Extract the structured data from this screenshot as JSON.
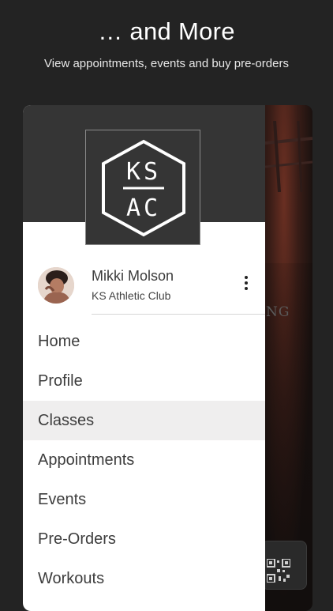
{
  "hero": {
    "title": "… and More",
    "subtitle": "View appointments, events and buy pre-orders"
  },
  "logo": {
    "line1": "KS",
    "line2": "AC"
  },
  "user": {
    "name": "Mikki Molson",
    "club": "KS Athletic Club"
  },
  "menu": {
    "items": [
      {
        "label": "Home",
        "active": false
      },
      {
        "label": "Profile",
        "active": false
      },
      {
        "label": "Classes",
        "active": true
      },
      {
        "label": "Appointments",
        "active": false
      },
      {
        "label": "Events",
        "active": false
      },
      {
        "label": "Pre-Orders",
        "active": false
      },
      {
        "label": "Workouts",
        "active": false
      }
    ]
  },
  "background": {
    "text": "NG"
  },
  "colors": {
    "page_bg": "#232323",
    "drawer_header": "#353535",
    "active_item_bg": "#efeeee"
  },
  "icons": {
    "more": "more-vertical-icon",
    "qr": "qr-code-icon"
  }
}
